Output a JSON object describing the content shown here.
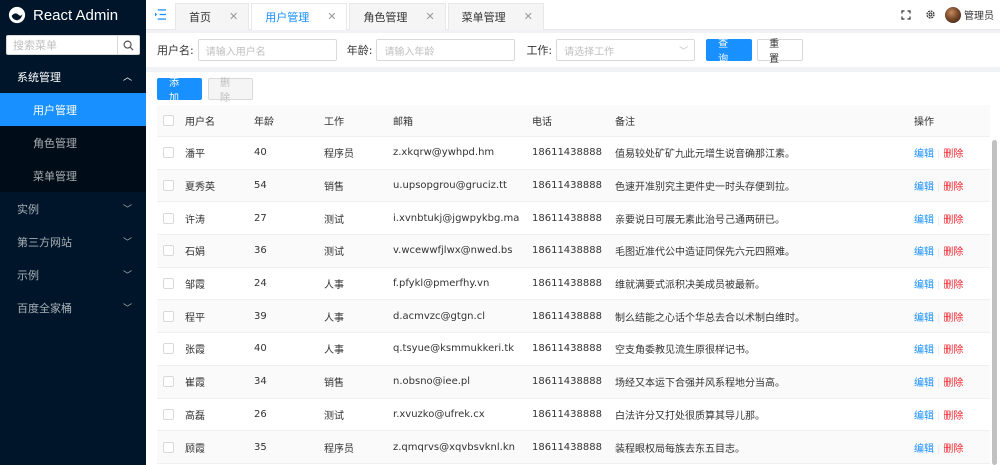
{
  "app": {
    "title": "React Admin"
  },
  "sidebar": {
    "search_placeholder": "搜索菜单",
    "groups": [
      {
        "label": "系统管理",
        "expanded": true,
        "children": [
          {
            "label": "用户管理",
            "active": true
          },
          {
            "label": "角色管理"
          },
          {
            "label": "菜单管理"
          }
        ]
      },
      {
        "label": "实例"
      },
      {
        "label": "第三方网站"
      },
      {
        "label": "示例"
      },
      {
        "label": "百度全家桶"
      }
    ]
  },
  "header": {
    "tabs": [
      {
        "label": "首页"
      },
      {
        "label": "用户管理",
        "active": true
      },
      {
        "label": "角色管理"
      },
      {
        "label": "菜单管理"
      }
    ],
    "user_name": "管理员"
  },
  "filter": {
    "username_label": "用户名:",
    "username_placeholder": "请输入用户名",
    "age_label": "年龄:",
    "age_placeholder": "请输入年龄",
    "job_label": "工作:",
    "job_placeholder": "请选择工作",
    "query_label": "查 询",
    "reset_label": "重 置"
  },
  "actions": {
    "add_label": "添 加",
    "delete_label": "删 除"
  },
  "table": {
    "headers": [
      "用户名",
      "年龄",
      "工作",
      "邮箱",
      "电话",
      "备注",
      "操作"
    ],
    "edit_label": "编辑",
    "delete_label": "删除",
    "rows": [
      {
        "name": "潘平",
        "age": "40",
        "job": "程序员",
        "email": "z.xkqrw@ywhpd.hm",
        "phone": "18611438888",
        "note": "值易较处矿矿九此元增生说音确那江素。"
      },
      {
        "name": "夏秀英",
        "age": "54",
        "job": "销售",
        "email": "u.upsopgrou@gruciz.tt",
        "phone": "18611438888",
        "note": "色速开准别究主更件史一时头存便到拉。"
      },
      {
        "name": "许涛",
        "age": "27",
        "job": "测试",
        "email": "i.xvnbtukj@jgwpykbg.ma",
        "phone": "18611438888",
        "note": "亲要说日可展无素此治号己通两研已。"
      },
      {
        "name": "石娟",
        "age": "36",
        "job": "测试",
        "email": "v.wcewwfjlwx@nwed.bs",
        "phone": "18611438888",
        "note": "毛图近准代公中造证同保先六元四照难。"
      },
      {
        "name": "邹霞",
        "age": "24",
        "job": "人事",
        "email": "f.pfykl@pmerfhy.vn",
        "phone": "18611438888",
        "note": "维就满要式派积决美成员被最新。"
      },
      {
        "name": "程平",
        "age": "39",
        "job": "人事",
        "email": "d.acmvzc@gtgn.cl",
        "phone": "18611438888",
        "note": "制么结能之心话个华总去合以术制白维时。"
      },
      {
        "name": "张霞",
        "age": "40",
        "job": "人事",
        "email": "q.tsyue@ksmmukkeri.tk",
        "phone": "18611438888",
        "note": "空支角委教见流生原很样记书。"
      },
      {
        "name": "崔霞",
        "age": "34",
        "job": "销售",
        "email": "n.obsno@iee.pl",
        "phone": "18611438888",
        "note": "场经又本运下合强并风系程地分当高。"
      },
      {
        "name": "高磊",
        "age": "26",
        "job": "测试",
        "email": "r.xvuzko@ufrek.cx",
        "phone": "18611438888",
        "note": "白法许分又打处很质算其导儿那。"
      },
      {
        "name": "顾霞",
        "age": "35",
        "job": "程序员",
        "email": "z.qmqrvs@xqvbsvknl.kn",
        "phone": "18611438888",
        "note": "装程眼权局每族去东五目志。"
      }
    ]
  }
}
